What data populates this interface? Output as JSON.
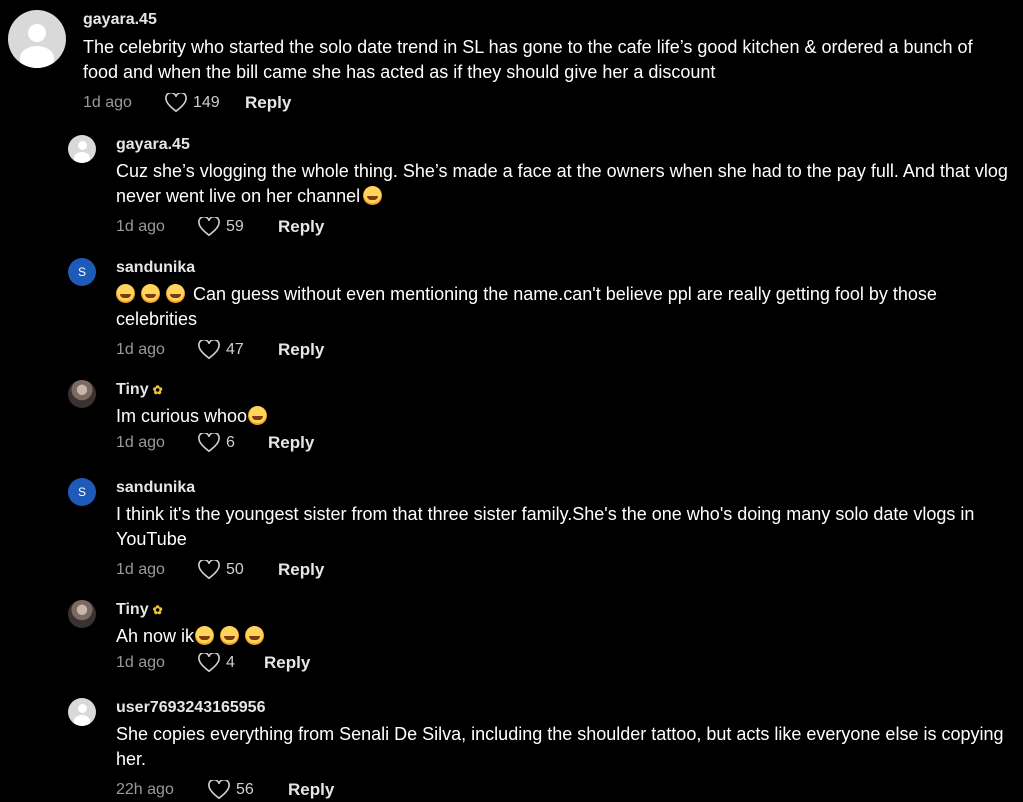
{
  "comments": [
    {
      "username": "gayara.45",
      "text": "The celebrity who started the solo date trend in SL has gone to the cafe life’s good kitchen & ordered a bunch of food and when the bill came she has acted as if they should give her a discount",
      "time": "1d ago",
      "likes": "149",
      "reply": "Reply",
      "avatar": "default-avatar-icon"
    },
    {
      "username": "gayara.45",
      "text": "Cuz she’s vlogging the whole thing. She’s made a face at the owners when she had to the pay full. And that vlog never went live on her channel",
      "time": "1d ago",
      "likes": "59",
      "reply": "Reply",
      "avatar": "default-avatar-icon"
    },
    {
      "username": "sandunika",
      "avatar_letter": "S",
      "text": "Can guess without even mentioning the name.can't believe ppl are really getting fool by those celebrities",
      "time": "1d ago",
      "likes": "47",
      "reply": "Reply"
    },
    {
      "username": "Tiny",
      "text": "Im curious whoo",
      "time": "1d ago",
      "likes": "6",
      "reply": "Reply",
      "avatar": "photo-avatar"
    },
    {
      "username": "sandunika",
      "avatar_letter": "S",
      "text": "I think it's the youngest sister from that three sister family.She's the one who's doing many solo date vlogs in YouTube",
      "time": "1d ago",
      "likes": "50",
      "reply": "Reply"
    },
    {
      "username": "Tiny",
      "text": "Ah now ik",
      "time": "1d ago",
      "likes": "4",
      "reply": "Reply",
      "avatar": "photo-avatar"
    },
    {
      "username": "user7693243165956",
      "text": "She copies everything from Senali De Silva, including the shoulder tattoo, but acts like everyone else is copying her.",
      "time": "22h ago",
      "likes": "56",
      "reply": "Reply",
      "avatar": "default-avatar-icon"
    }
  ],
  "colors": {
    "background": "#000000",
    "text": "#ffffff",
    "meta": "#9a9a9a",
    "letter_avatar": "#1e5bb8"
  }
}
